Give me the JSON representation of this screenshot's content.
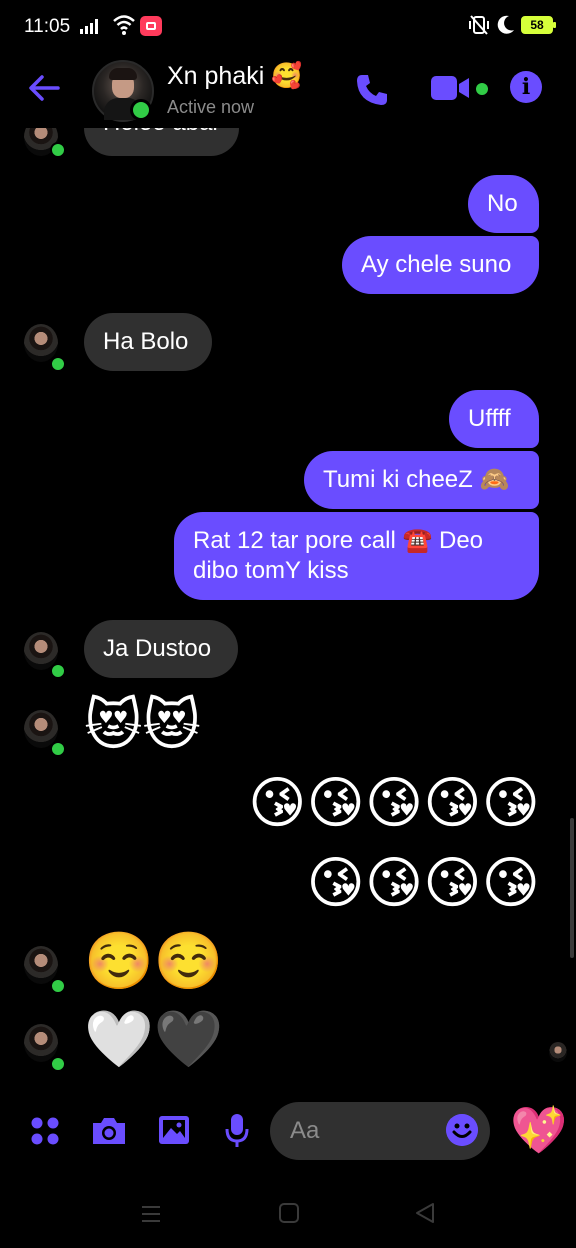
{
  "status_bar": {
    "time": "11:05",
    "battery": "58"
  },
  "header": {
    "contact_name": "Xn phaki 🥰",
    "presence": "Active now"
  },
  "messages": {
    "partial_top": "Holoo abar",
    "m1": "No",
    "m2": "Ay chele suno",
    "m3": "Ha Bolo",
    "m4": "Uffff",
    "m5": "Tumi ki cheeZ 🙈",
    "m6_line1": "Rat 12 tar pore call ☎️ Deo",
    "m6_line2": "dibo tomY kiss",
    "m7": "Ja Dustoo",
    "e1": "😻😻",
    "e2": "😘😘😘😘😘",
    "e3": "😘😘😘😘",
    "e4": "☺️☺️",
    "e5": "🤍🖤"
  },
  "composer": {
    "placeholder": "Aa",
    "quick_reaction": "💖"
  },
  "colors": {
    "accent": "#6a4dff",
    "received_bubble": "#303030",
    "online": "#31cc46",
    "background": "#000000"
  }
}
